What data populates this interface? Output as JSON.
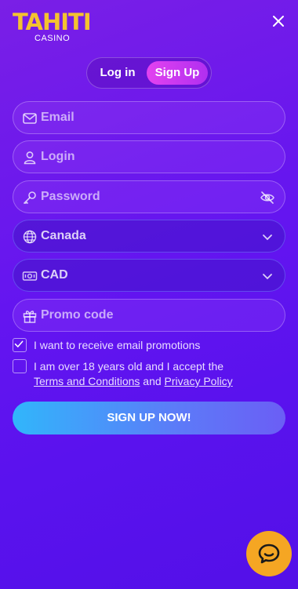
{
  "logo": {
    "main": "TAHITI",
    "sub": "CASINO"
  },
  "tabs": {
    "login": "Log in",
    "signup": "Sign Up"
  },
  "fields": {
    "email": {
      "placeholder": "Email"
    },
    "login": {
      "placeholder": "Login"
    },
    "password": {
      "placeholder": "Password"
    },
    "country": {
      "value": "Canada"
    },
    "currency": {
      "value": "CAD"
    },
    "promo": {
      "placeholder": "Promo code"
    }
  },
  "checkboxes": {
    "promotions": {
      "label": "I want to receive email promotions",
      "checked": true
    },
    "terms": {
      "label_prefix": "I am over 18 years old and I accept the",
      "terms_link": "Terms and Conditions",
      "and": "and",
      "privacy_link": "Privacy Policy",
      "checked": false
    }
  },
  "submit_label": "SIGN UP NOW!",
  "icons": {
    "close": "close-icon",
    "email": "envelope-icon",
    "login": "user-icon",
    "password": "key-icon",
    "visibility": "eye-off-icon",
    "country": "globe-icon",
    "currency": "banknote-icon",
    "promo": "gift-icon",
    "dropdown": "chevron-down-icon",
    "chat": "chat-icon"
  },
  "colors": {
    "accent_gold": "#f4c230",
    "signup_tab": "#d63ef0",
    "submit_start": "#31b6fb",
    "submit_end": "#6b5ef5"
  }
}
